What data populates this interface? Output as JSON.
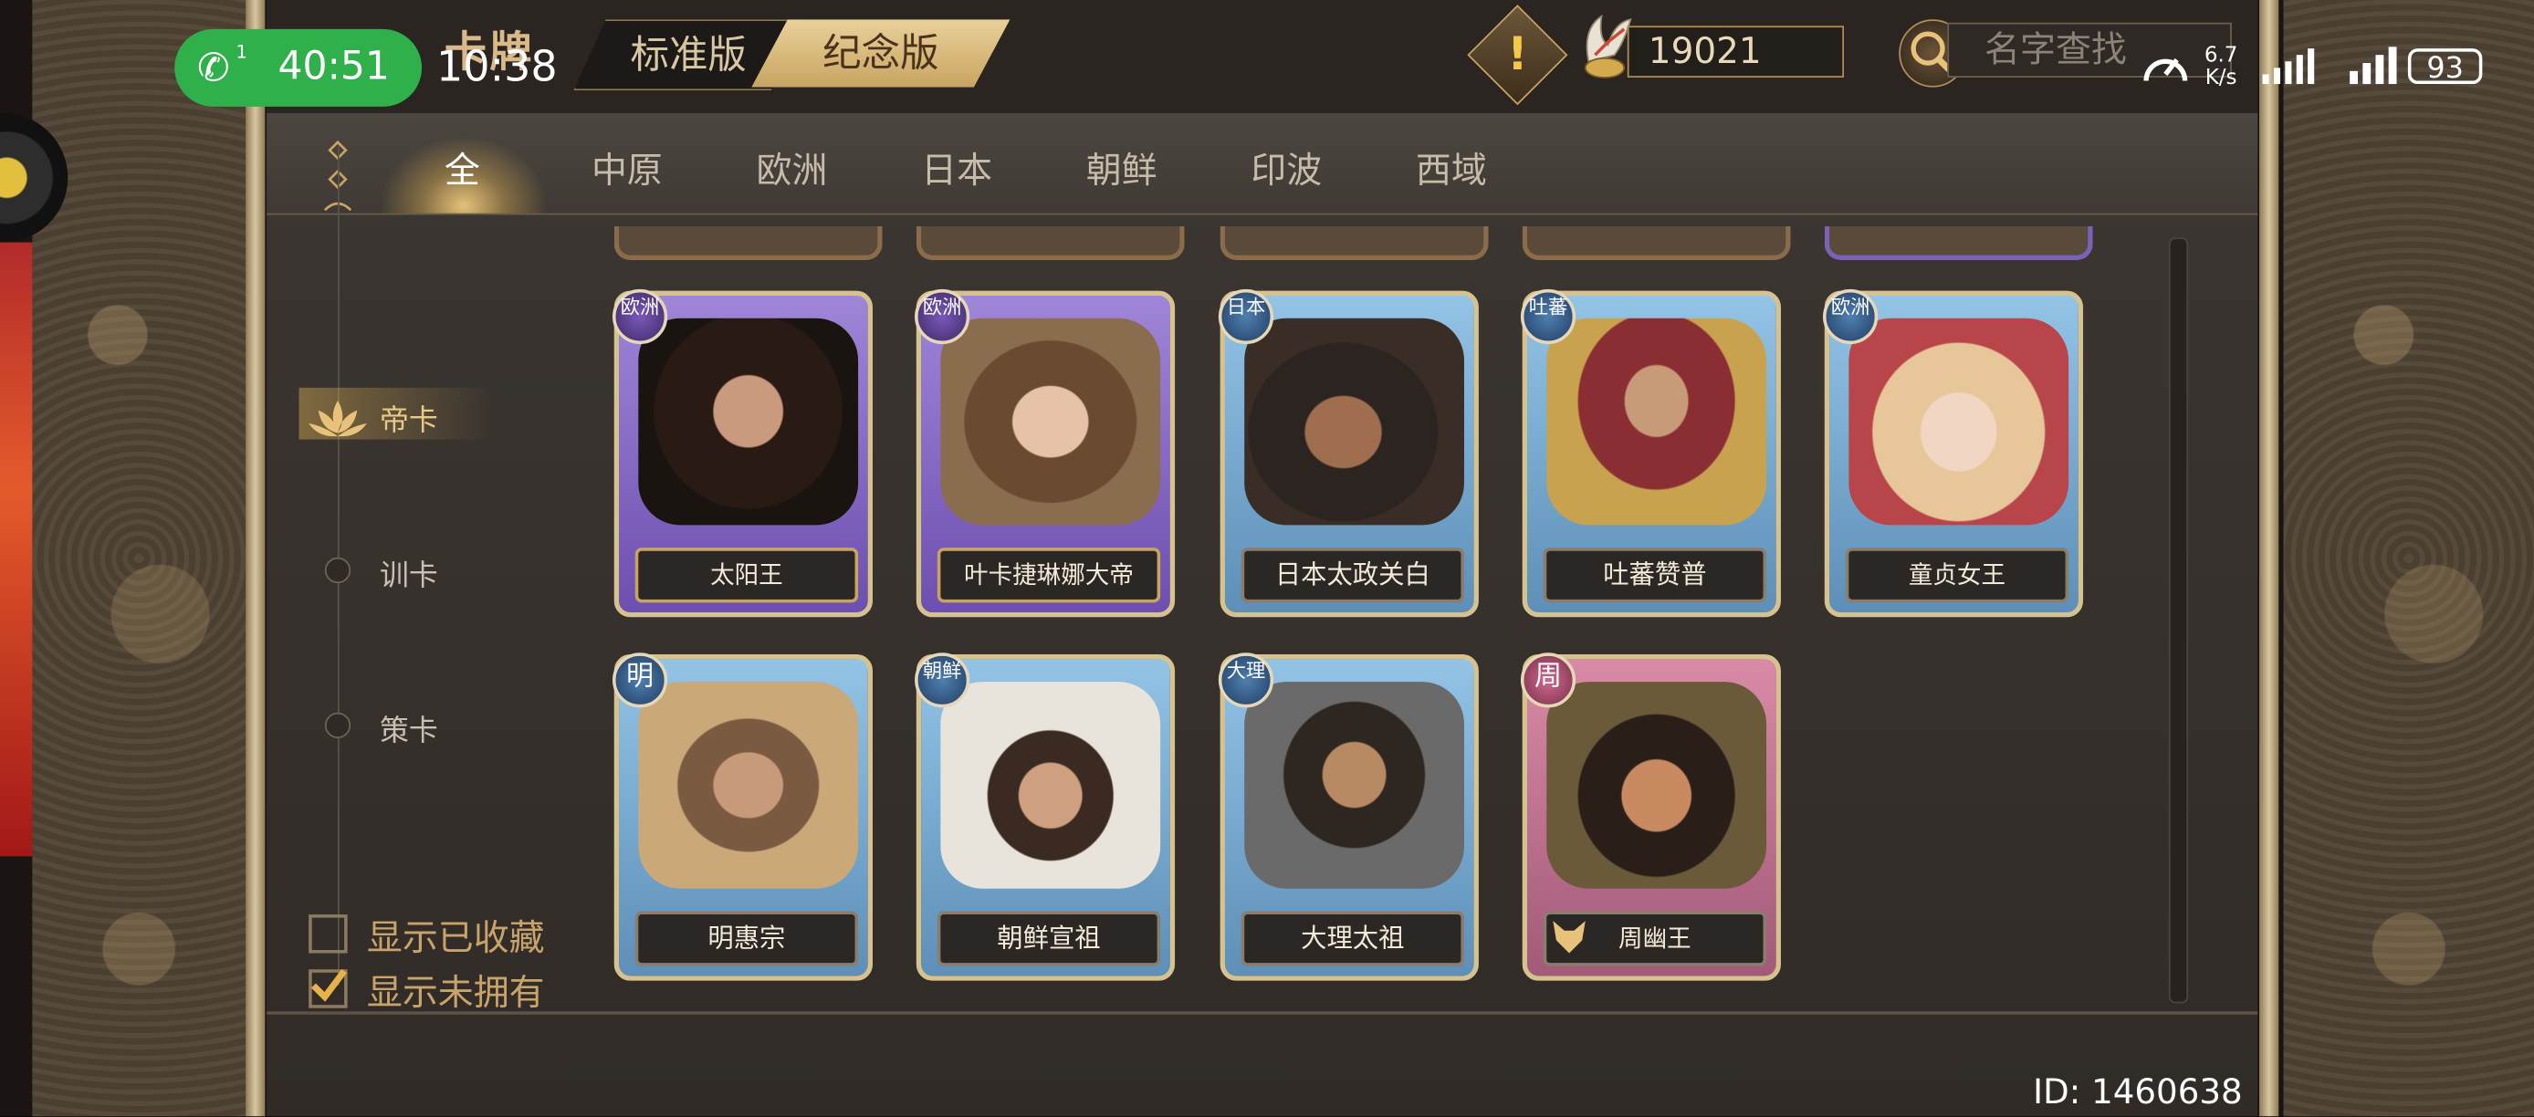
{
  "status_bar": {
    "call_duration": "40:51",
    "call_line": "1",
    "time": "10:38",
    "net_speed_value": "6.7",
    "net_speed_unit": "K/s",
    "battery": "93"
  },
  "header": {
    "title": "卡牌",
    "version_tabs": [
      "标准版",
      "纪念版"
    ],
    "active_version": "纪念版",
    "currency": "19021",
    "search_placeholder": "名字查找"
  },
  "categories": [
    "全",
    "中原",
    "欧洲",
    "日本",
    "朝鲜",
    "印波",
    "西域"
  ],
  "active_category": "全",
  "filters": [
    {
      "label": "帝卡",
      "active": true
    },
    {
      "label": "训卡",
      "active": false
    },
    {
      "label": "策卡",
      "active": false
    }
  ],
  "checkboxes": [
    {
      "label": "显示已收藏",
      "checked": false
    },
    {
      "label": "显示未拥有",
      "checked": true
    }
  ],
  "cards_row1": [
    {
      "name": "太阳王",
      "badge": "欧洲",
      "frame": "purple",
      "deco": "◆◆"
    },
    {
      "name": "叶卡捷琳娜大帝",
      "badge": "欧洲",
      "frame": "purple",
      "deco": "◆◆"
    },
    {
      "name": "日本太政关白",
      "badge": "日本",
      "frame": "blue",
      "deco": ""
    },
    {
      "name": "吐蕃赞普",
      "badge": "吐蕃",
      "frame": "blue",
      "deco": ""
    },
    {
      "name": "童贞女王",
      "badge": "欧洲",
      "frame": "blue",
      "deco": "◆◆"
    }
  ],
  "cards_row2": [
    {
      "name": "明惠宗",
      "badge": "明",
      "frame": "blue",
      "deco": ""
    },
    {
      "name": "朝鲜宣祖",
      "badge": "朝鲜",
      "frame": "blue",
      "deco": ""
    },
    {
      "name": "大理太祖",
      "badge": "大理",
      "frame": "blue",
      "deco": ""
    },
    {
      "name": "周幽王",
      "badge": "周",
      "frame": "pink",
      "deco": "◆◆"
    }
  ],
  "footer": {
    "user_id": "ID: 1460638"
  },
  "colors": {
    "accent_gold": "#c9a461",
    "call_green": "#2fb04a",
    "purple_frame": "#7d61c0",
    "blue_frame": "#7aaed6",
    "pink_frame": "#c06a8c"
  }
}
